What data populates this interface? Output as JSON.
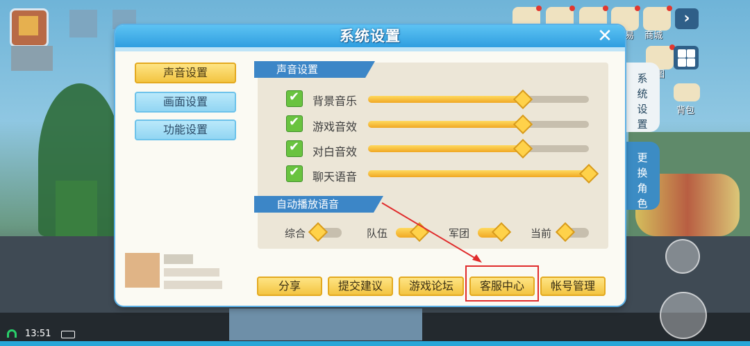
{
  "dialog": {
    "title": "系统设置",
    "close": "✕"
  },
  "menu": [
    {
      "label": "声音设置",
      "active": true
    },
    {
      "label": "画面设置",
      "active": false
    },
    {
      "label": "功能设置",
      "active": false
    }
  ],
  "sound_section": {
    "title": "声音设置",
    "items": [
      {
        "label": "背景音乐",
        "checked": true,
        "level": 0.7
      },
      {
        "label": "游戏音效",
        "checked": true,
        "level": 0.7
      },
      {
        "label": "对白音效",
        "checked": true,
        "level": 0.7
      },
      {
        "label": "聊天语音",
        "checked": true,
        "level": 1.0
      }
    ]
  },
  "autoplay_section": {
    "title": "自动播放语音",
    "toggles": [
      {
        "label": "综合",
        "on": false
      },
      {
        "label": "队伍",
        "on": true
      },
      {
        "label": "军团",
        "on": true
      },
      {
        "label": "当前",
        "on": false
      }
    ]
  },
  "footer_buttons": [
    "分享",
    "提交建议",
    "游戏论坛",
    "客服中心",
    "帐号管理"
  ],
  "highlight_color": "#e02b2b",
  "top_right": {
    "labels": [
      "易",
      "商城",
      "图",
      "背包"
    ]
  },
  "side_tabs": [
    {
      "label": "系\n统\n设\n置"
    },
    {
      "label": "更\n换\n角\n色"
    }
  ],
  "status": {
    "time": "13:51"
  }
}
